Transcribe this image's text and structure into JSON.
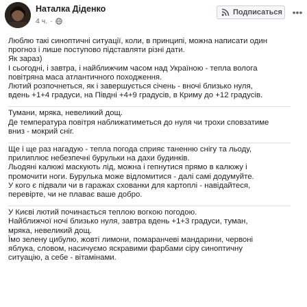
{
  "post": {
    "author": "Наталка Діденко",
    "time": "4 ч.",
    "privacy_icon": "globe-icon",
    "subscribe_label": "Подписаться",
    "subscribe_icon": "rss-icon",
    "more_icon": "more-dots-icon",
    "paragraphs": [
      {
        "lines": [
          "Люблю такі синоптичні ситуації, коли, в принципі, можна написати один",
          "прогноз і лише поступово підставляти різні дати.",
          "Як зараз)",
          "І сьогодні, і завтра, і найближчим часом над Україною - тепла волога",
          "повітряна маса атлантичного походження.",
          "Лютий розпочнеться, як і завершується січень - вночі близько нуля,",
          "вдень +1+4 градуси, на Півдні +4+9 градусів, в Криму до +12 градусів."
        ]
      },
      {
        "lines": [
          "Тумани, мряка, невеликий дощ.",
          "Де температура повітря наближатиметься до нуля чи трохи сповзатиме",
          "вниз - мокрий сніг."
        ]
      },
      {
        "lines": [
          "Ще і ще раз нагадую - тепла погода сприяє таненню снігу та льоду,",
          "прилиплює небезпечні бурульки на дахи будинків.",
          "Льодяні калюжі маскують лід, можна і гепнутися прямо в калюжу і",
          "промочити ноги. Бурулька може відломитися - далі самі додумуйте.",
          "У кого є підвали чи в гаражах схованки для картоплі - навідайтеся,",
          "перевірте, чи не плаває ваше добро."
        ]
      },
      {
        "lines": [
          "У Києві лютий починається теплою вогкою погодою.",
          "Найближчої ночі близько нуля, завтра вдень +1+3 градуси, туман,",
          "мряка, невеликий дощ.",
          "Їмо зелену цибулю, жовті лимони, помаранчеві мандарини, червоні",
          "яблука, словом, насичуємо яскравими фарбами сіру синоптичну",
          "ситуацію, а себе - вітамінами."
        ]
      }
    ]
  }
}
